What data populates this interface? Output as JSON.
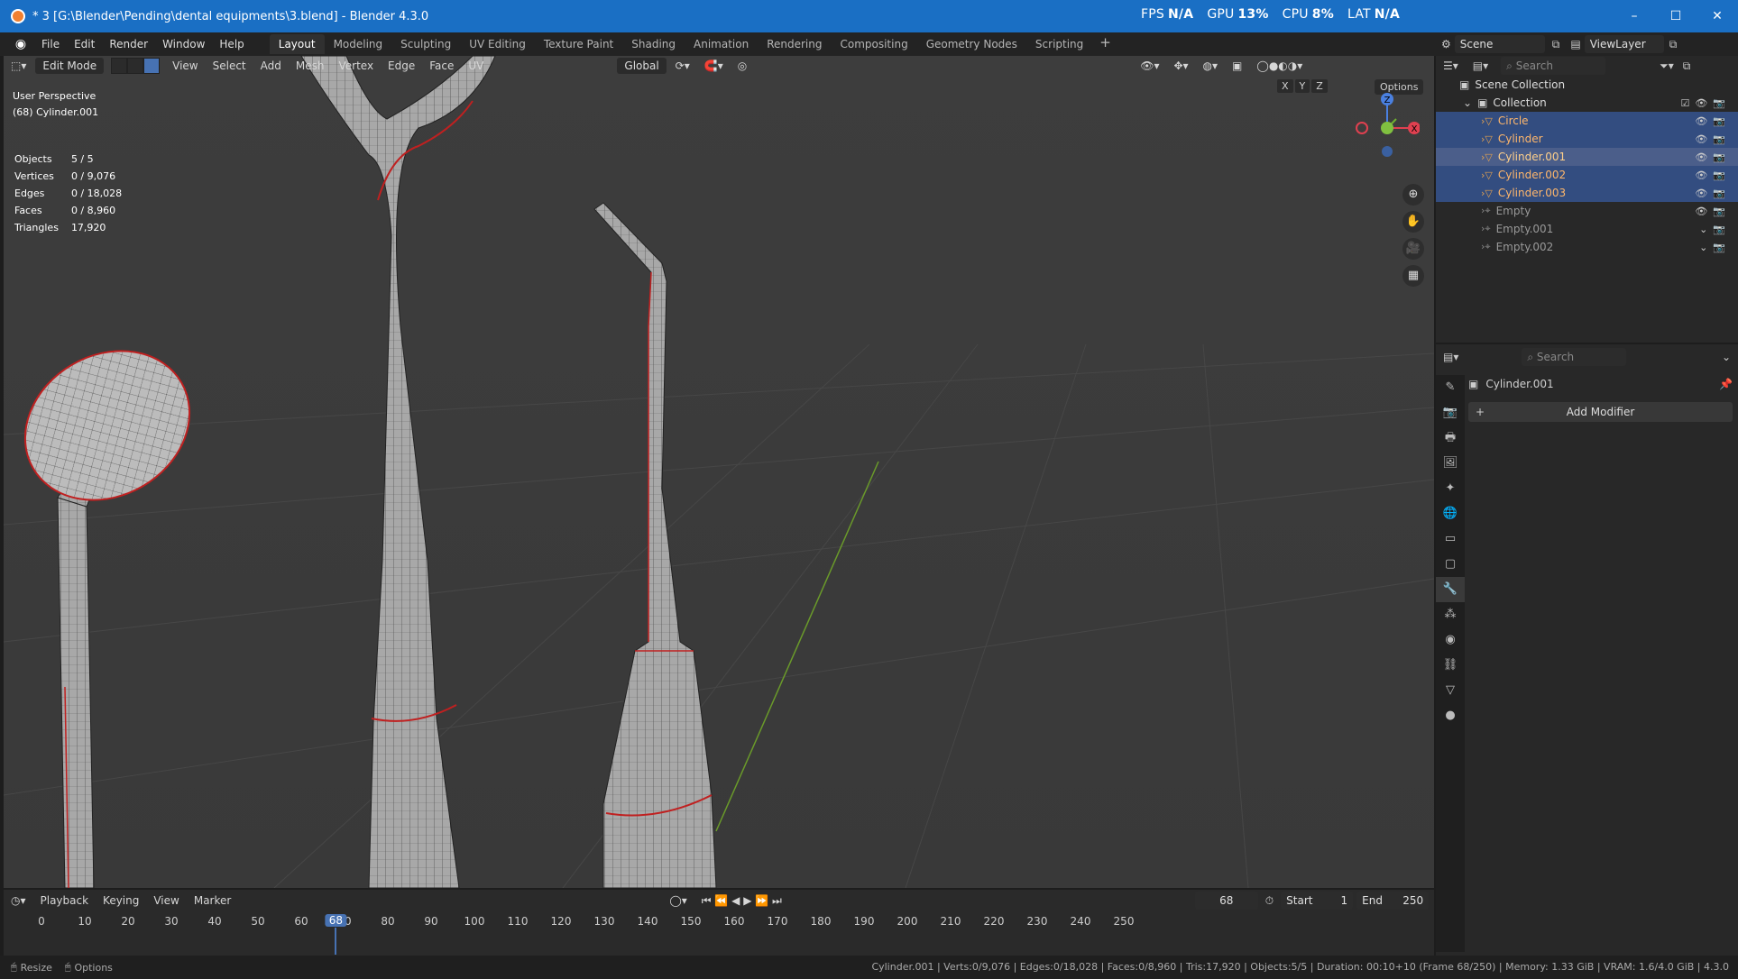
{
  "window": {
    "title": "* 3 [G:\\Blender\\Pending\\dental equipments\\3.blend] - Blender 4.3.0",
    "perf": [
      {
        "label": "FPS",
        "value": "N/A"
      },
      {
        "label": "GPU",
        "value": "13%"
      },
      {
        "label": "CPU",
        "value": "8%"
      },
      {
        "label": "LAT",
        "value": "N/A"
      }
    ],
    "buttons": [
      "–",
      "☐",
      "✕"
    ]
  },
  "menubar": {
    "menus": [
      "File",
      "Edit",
      "Render",
      "Window",
      "Help"
    ],
    "workspaces": [
      "Layout",
      "Modeling",
      "Sculpting",
      "UV Editing",
      "Texture Paint",
      "Shading",
      "Animation",
      "Rendering",
      "Compositing",
      "Geometry Nodes",
      "Scripting"
    ],
    "active_workspace": "Layout",
    "add_tab": "+"
  },
  "scene": {
    "name": "Scene",
    "viewlayer": "ViewLayer"
  },
  "viewport": {
    "mode": "Edit Mode",
    "menus": [
      "View",
      "Select",
      "Add",
      "Mesh",
      "Vertex",
      "Edge",
      "Face",
      "UV"
    ],
    "orientation": "Global",
    "options": "Options",
    "axes": [
      "X",
      "Y",
      "Z"
    ],
    "perspective": "User Perspective",
    "object": "(68) Cylinder.001",
    "stats": [
      {
        "label": "Objects",
        "value": "5 / 5"
      },
      {
        "label": "Vertices",
        "value": "0 / 9,076"
      },
      {
        "label": "Edges",
        "value": "0 / 18,028"
      },
      {
        "label": "Faces",
        "value": "0 / 8,960"
      },
      {
        "label": "Triangles",
        "value": "17,920"
      }
    ],
    "gizmo": {
      "x": "X",
      "y": "Y",
      "z": "Z"
    }
  },
  "outliner": {
    "search_placeholder": "Search",
    "root": "Scene Collection",
    "collection": "Collection",
    "items": [
      {
        "name": "Circle",
        "state": "sel"
      },
      {
        "name": "Cylinder",
        "state": "sel"
      },
      {
        "name": "Cylinder.001",
        "state": "active"
      },
      {
        "name": "Cylinder.002",
        "state": "sel"
      },
      {
        "name": "Cylinder.003",
        "state": "sel"
      },
      {
        "name": "Empty",
        "state": "empty"
      },
      {
        "name": "Empty.001",
        "state": "empty"
      },
      {
        "name": "Empty.002",
        "state": "empty"
      }
    ]
  },
  "properties": {
    "search_placeholder": "Search",
    "object_name": "Cylinder.001",
    "add_modifier": "Add Modifier"
  },
  "timeline": {
    "menus": [
      "Playback",
      "Keying",
      "View",
      "Marker"
    ],
    "current_frame": "68",
    "start_label": "Start",
    "start": "1",
    "end_label": "End",
    "end": "250",
    "ticks": [
      "0",
      "10",
      "20",
      "30",
      "40",
      "50",
      "60",
      "70",
      "80",
      "90",
      "100",
      "110",
      "120",
      "130",
      "140",
      "150",
      "160",
      "170",
      "180",
      "190",
      "200",
      "210",
      "220",
      "230",
      "240",
      "250"
    ]
  },
  "statusbar": {
    "left": [
      "Resize",
      "Options"
    ],
    "right": "Cylinder.001 | Verts:0/9,076 | Edges:0/18,028 | Faces:0/8,960 | Tris:17,920 | Objects:5/5 | Duration: 00:10+10 (Frame 68/250) | Memory: 1.33 GiB | VRAM: 1.6/4.0 GiB | 4.3.0"
  }
}
